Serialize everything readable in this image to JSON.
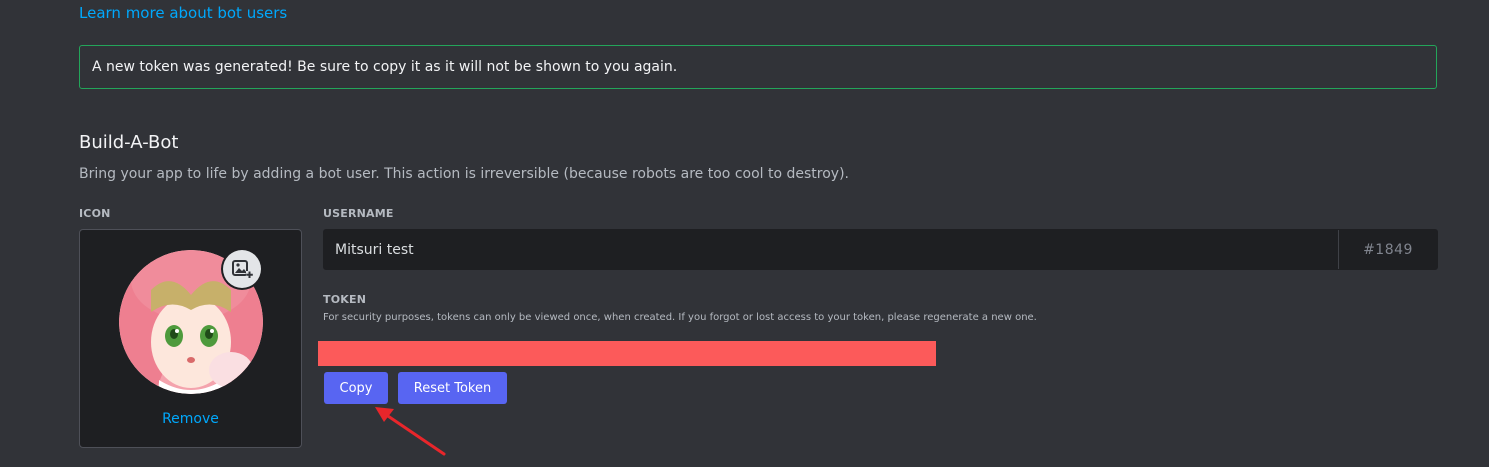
{
  "learn_link": "Learn more about bot users",
  "notice": "A new token was generated! Be sure to copy it as it will not be shown to you again.",
  "section": {
    "title": "Build-A-Bot",
    "description": "Bring your app to life by adding a bot user. This action is irreversible (because robots are too cool to destroy)."
  },
  "icon_field": {
    "label": "ICON",
    "remove_label": "Remove",
    "upload_icon": "image-add-icon"
  },
  "username_field": {
    "label": "USERNAME",
    "value": "Mitsuri test",
    "discriminator": "#1849"
  },
  "token_field": {
    "label": "TOKEN",
    "help": "For security purposes, tokens can only be viewed once, when created. If you forgot or lost access to your token, please regenerate a new one."
  },
  "buttons": {
    "copy": "Copy",
    "reset": "Reset Token"
  },
  "colors": {
    "background": "#313338",
    "accent": "#5865f2",
    "link": "#00a8fc",
    "success_border": "#23a55a",
    "redaction": "#fc5a5a",
    "annotation_arrow": "#e8262b"
  }
}
